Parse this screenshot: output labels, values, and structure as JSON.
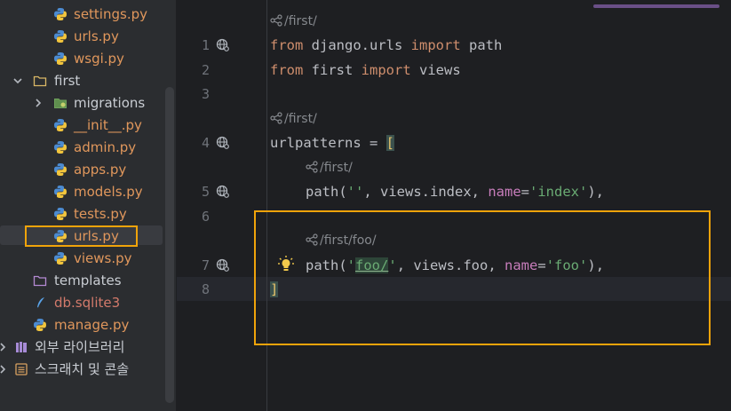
{
  "project_tree": {
    "items": [
      {
        "label": "settings.py",
        "kind": "python-file"
      },
      {
        "label": "urls.py",
        "kind": "python-file"
      },
      {
        "label": "wsgi.py",
        "kind": "python-file"
      },
      {
        "label": "first",
        "kind": "folder",
        "expanded": true
      },
      {
        "label": "migrations",
        "kind": "package",
        "expanded": false
      },
      {
        "label": "__init__.py",
        "kind": "python-file"
      },
      {
        "label": "admin.py",
        "kind": "python-file"
      },
      {
        "label": "apps.py",
        "kind": "python-file"
      },
      {
        "label": "models.py",
        "kind": "python-file"
      },
      {
        "label": "tests.py",
        "kind": "python-file"
      },
      {
        "label": "urls.py",
        "kind": "python-file",
        "selected": true
      },
      {
        "label": "views.py",
        "kind": "python-file"
      },
      {
        "label": "templates",
        "kind": "folder"
      },
      {
        "label": "db.sqlite3",
        "kind": "db-file"
      },
      {
        "label": "manage.py",
        "kind": "python-file"
      },
      {
        "label": "외부 라이브러리",
        "kind": "libraries"
      },
      {
        "label": "스크래치 및 콘솔",
        "kind": "scratches"
      }
    ]
  },
  "editor": {
    "hints": {
      "h1": "/first/",
      "h2": "/first/",
      "h3": "/first/",
      "h4": "/first/foo/"
    },
    "line_numbers": [
      "1",
      "2",
      "3",
      "4",
      "5",
      "6",
      "7",
      "8"
    ],
    "code": {
      "l1_kw1": "from",
      "l1_mid": " django.urls ",
      "l1_kw2": "import",
      "l1_end": " path",
      "l2_kw1": "from",
      "l2_mid": " first ",
      "l2_kw2": "import",
      "l2_end": " views",
      "l4_a": "urlpatterns = ",
      "l4_b": "[",
      "l5_a": "path(",
      "l5_s1": "''",
      "l5_b": ", views.index, ",
      "l5_p": "name",
      "l5_eq": "=",
      "l5_s2": "'index'",
      "l5_c": "),",
      "l7_a": "path(",
      "l7_q1": "'",
      "l7_foo": "foo/",
      "l7_q2": "'",
      "l7_b": ", views.foo, ",
      "l7_p": "name",
      "l7_eq": "=",
      "l7_s2": "'foo'",
      "l7_c": "),",
      "l8": "]"
    }
  },
  "colors": {
    "highlight_box": "#f0a30a",
    "keyword": "#cf8e6d",
    "string": "#6aab73",
    "named_param": "#c77dbb"
  }
}
